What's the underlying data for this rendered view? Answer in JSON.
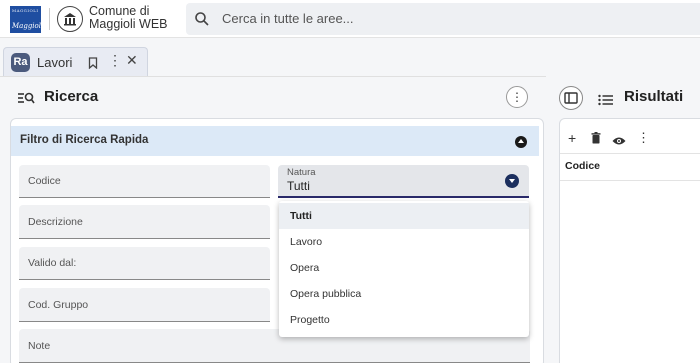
{
  "header": {
    "logo_text_top": "MAGGIOLI",
    "logo_text_bottom": "Maggioli",
    "app_title": "Comune di Maggioli WEB",
    "search_placeholder": "Cerca in tutte le aree..."
  },
  "tab": {
    "badge": "Ra",
    "label": "Lavori",
    "more": "⋮",
    "close": "✕"
  },
  "search_panel": {
    "title": "Ricerca",
    "more": "⋮",
    "filter_title": "Filtro di Ricerca Rapida",
    "fields": {
      "codice": "Codice",
      "descrizione": "Descrizione",
      "valido_dal": "Valido dal:",
      "cod_gruppo": "Cod. Gruppo",
      "note": "Note"
    },
    "natura": {
      "label": "Natura",
      "value": "Tutti",
      "options": [
        "Tutti",
        "Lavoro",
        "Opera",
        "Opera pubblica",
        "Progetto"
      ]
    }
  },
  "results_panel": {
    "title": "Risultati",
    "toolbar": {
      "add": "+",
      "more": "⋮"
    },
    "columns": [
      "Codice"
    ]
  },
  "colors": {
    "accent_dark": "#1c2f5e",
    "header_blue": "#dce9f7",
    "highlight": "#ffff00"
  }
}
